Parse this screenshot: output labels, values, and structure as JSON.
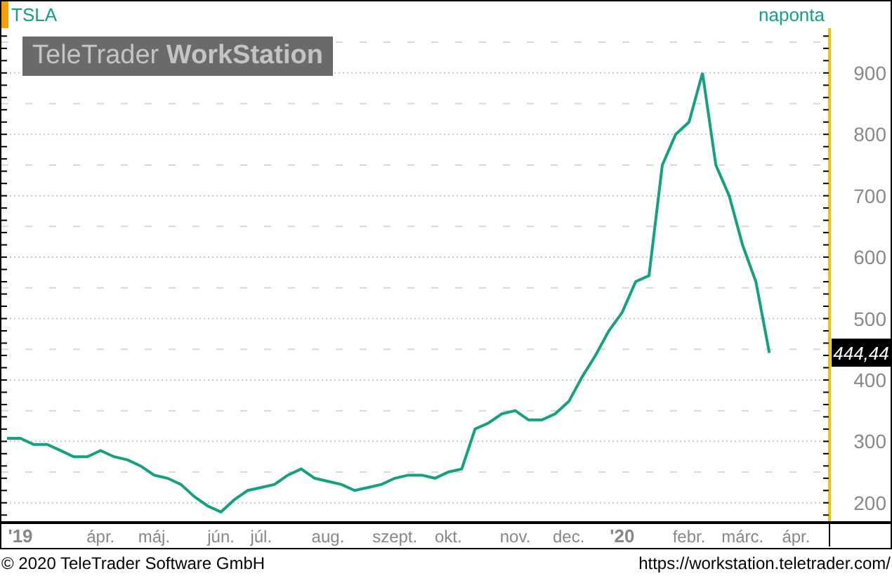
{
  "header": {
    "interval": "naponta"
  },
  "logo": {
    "text": "TeleTrader **WorkStation**"
  },
  "chart": {
    "last_price": "444,44",
    "chart_data": {
      "type": "line",
      "categories": [
        null,
        "'19",
        null,
        null,
        null,
        null,
        null,
        "ápr.",
        null,
        null,
        null,
        "máj.",
        null,
        null,
        null,
        null,
        "jún.",
        null,
        null,
        "júl.",
        null,
        null,
        null,
        null,
        "aug.",
        null,
        null,
        null,
        null,
        "szept.",
        null,
        null,
        null,
        "okt.",
        null,
        null,
        null,
        null,
        "nov.",
        null,
        null,
        null,
        "dec.",
        null,
        null,
        null,
        "'20",
        null,
        null,
        null,
        null,
        "febr.",
        null,
        null,
        null,
        "márc.",
        null,
        null,
        null,
        "ápr."
      ],
      "series": [
        {
          "name": "TSLA",
          "color": "#10a37f",
          "values": [
            305,
            305,
            295,
            295,
            285,
            275,
            275,
            285,
            275,
            270,
            260,
            245,
            240,
            230,
            210,
            195,
            185,
            205,
            220,
            225,
            230,
            245,
            255,
            240,
            235,
            230,
            220,
            225,
            230,
            240,
            245,
            245,
            240,
            250,
            255,
            320,
            330,
            345,
            350,
            335,
            335,
            345,
            365,
            405,
            440,
            480,
            510,
            560,
            570,
            750,
            800,
            820,
            900,
            750,
            700,
            620,
            560,
            444,
            null,
            null
          ]
        }
      ],
      "ylim": [
        170,
        973
      ],
      "grid": true,
      "yticks": [
        200,
        300,
        400,
        500,
        600,
        700,
        800,
        900
      ]
    }
  },
  "footer": {
    "copyright": "© 2020 TeleTrader Software GmbH",
    "url": "https://workstation.teletrader.com/"
  }
}
